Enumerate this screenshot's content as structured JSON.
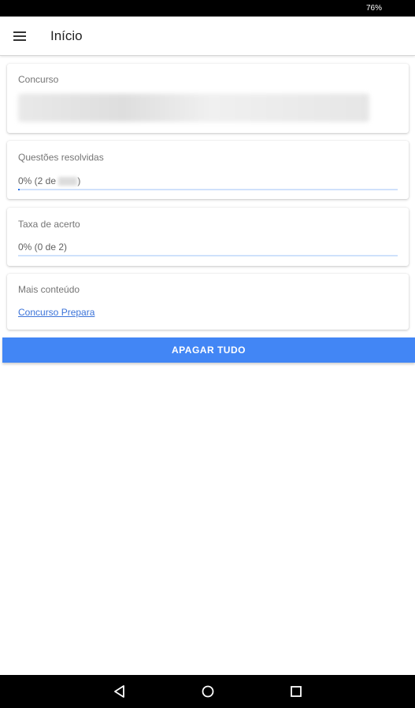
{
  "status_bar": {
    "battery": "76%"
  },
  "app_bar": {
    "title": "Início",
    "menu_icon": "hamburger-menu-icon"
  },
  "cards": {
    "concurso": {
      "label": "Concurso"
    },
    "questoes": {
      "label": "Questões resolvidas",
      "value_prefix": "0% (2 de ",
      "value_suffix": ")",
      "progress": 0.005
    },
    "taxa": {
      "label": "Taxa de acerto",
      "value": "0% (0 de 2)",
      "progress": 0
    },
    "mais": {
      "label": "Mais conteúdo",
      "link": "Concurso Prepara"
    }
  },
  "actions": {
    "delete_all": "APAGAR TUDO"
  },
  "nav_bar": {
    "back_icon": "back-triangle-icon",
    "home_icon": "home-circle-icon",
    "recents_icon": "recents-square-icon"
  },
  "colors": {
    "accent": "#4286f5",
    "progress": "#2a73e8",
    "progress_track": "#cfe1fb",
    "link": "#3b73d9"
  }
}
